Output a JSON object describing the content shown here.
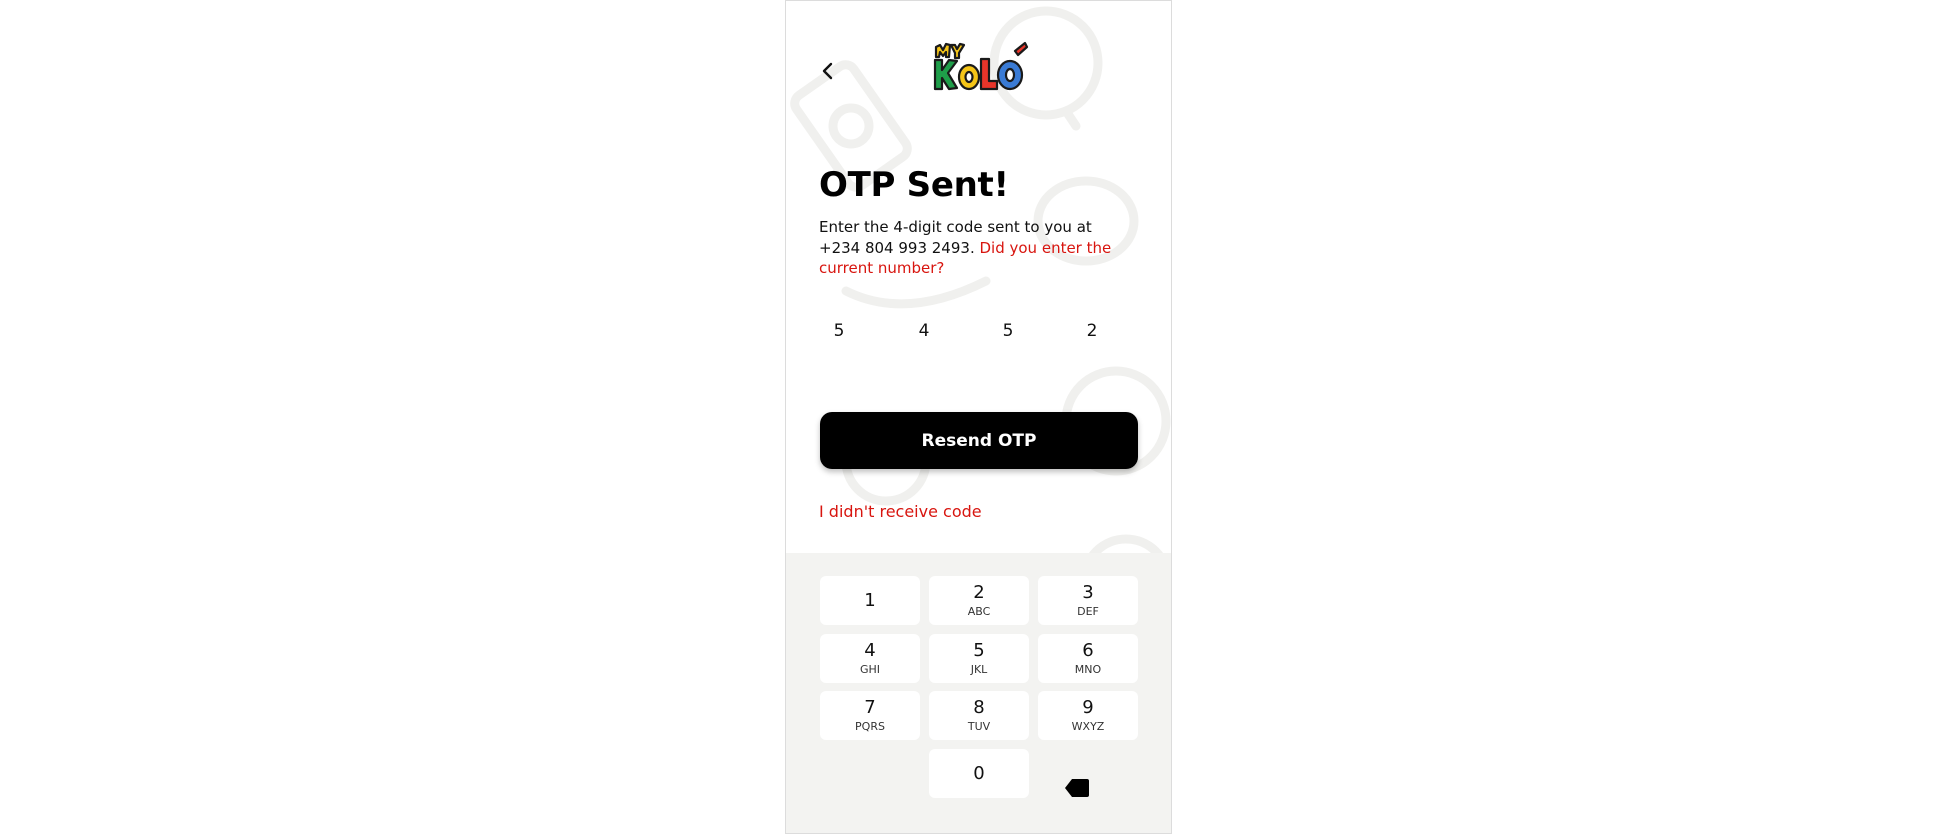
{
  "header": {
    "back_icon": "chevron-left-icon",
    "logo_text": "MY KOLO"
  },
  "main": {
    "title": "OTP Sent!",
    "description": "Enter the 4-digit code sent to you at +234 804 993 2493.",
    "description_link": "Did you enter the current number?",
    "otp_digits": [
      "5",
      "4",
      "5",
      "2"
    ],
    "resend_label": "Resend OTP",
    "not_received_label": "I didn't receive code"
  },
  "keypad": {
    "keys": [
      {
        "num": "1",
        "letters": ""
      },
      {
        "num": "2",
        "letters": "ABC"
      },
      {
        "num": "3",
        "letters": "DEF"
      },
      {
        "num": "4",
        "letters": "GHI"
      },
      {
        "num": "5",
        "letters": "JKL"
      },
      {
        "num": "6",
        "letters": "MNO"
      },
      {
        "num": "7",
        "letters": "PQRS"
      },
      {
        "num": "8",
        "letters": "TUV"
      },
      {
        "num": "9",
        "letters": "WXYZ"
      },
      {
        "num": "0",
        "letters": ""
      }
    ],
    "backspace_icon": "backspace-icon"
  },
  "colors": {
    "accent_red": "#d8150f",
    "button_black": "#000000",
    "keypad_bg": "#f3f3f1"
  }
}
